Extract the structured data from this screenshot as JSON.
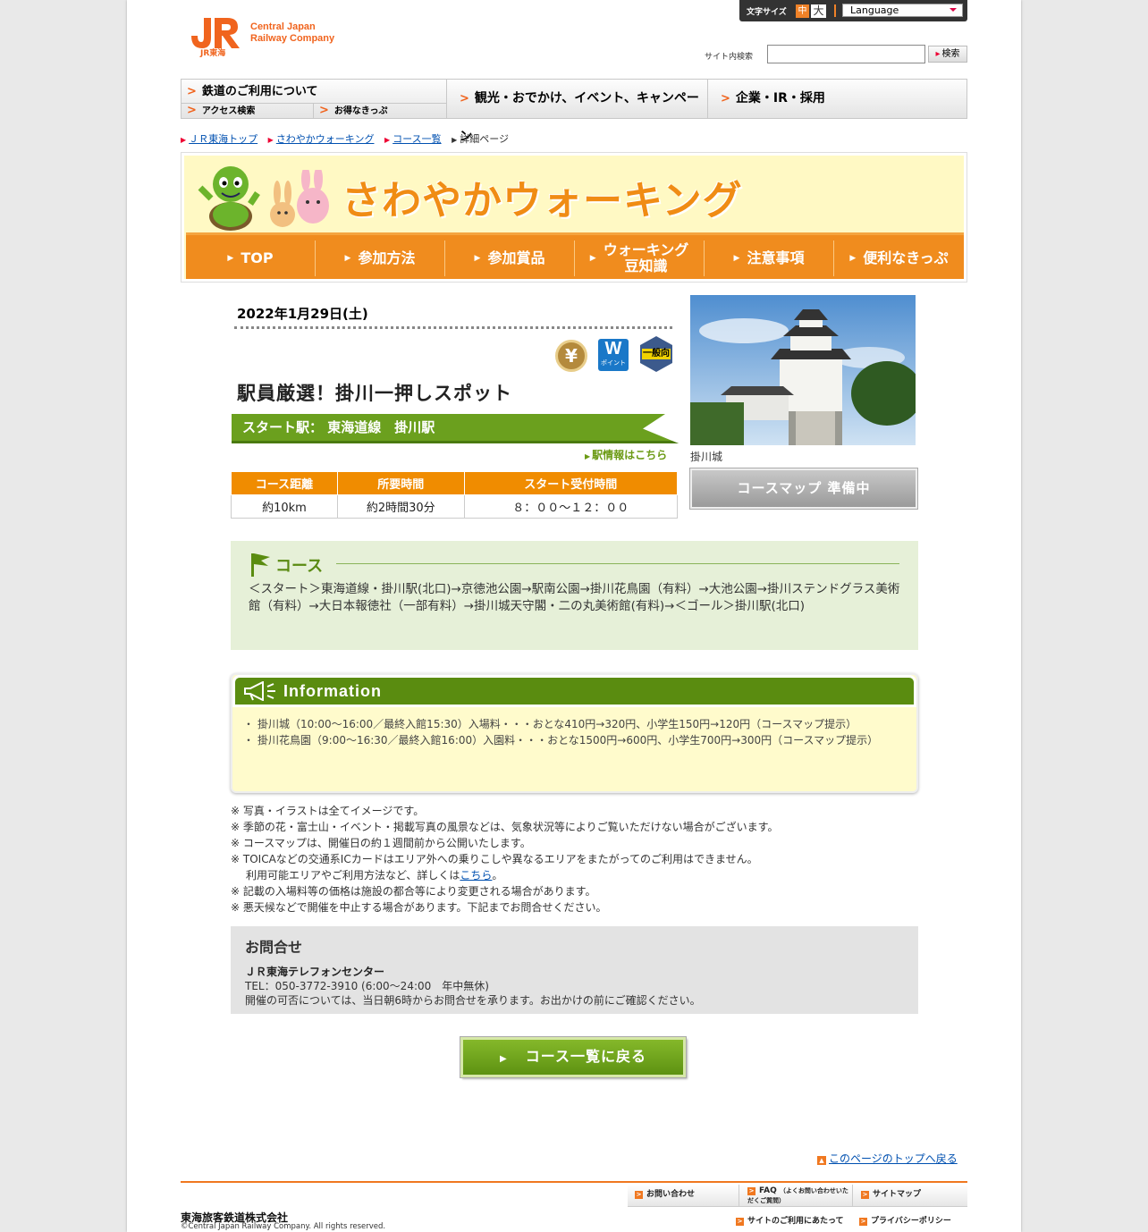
{
  "header": {
    "logo_sub": "JR東海",
    "logo_en_line1": "Central Japan",
    "logo_en_line2": "Railway Company",
    "font_size_label": "文字サイズ",
    "font_size_mid": "中",
    "font_size_large": "大",
    "language_label": "Language",
    "search_label": "サイト内検索",
    "search_value": "",
    "search_button": "検索"
  },
  "global_nav": {
    "rail": "鉄道のご利用について",
    "access": "アクセス検索",
    "tickets": "お得なきっぷ",
    "tourism": "観光・おでかけ、イベント、キャンペーン",
    "corporate": "企業・IR・採用"
  },
  "breadcrumb": [
    "ＪＲ東海トップ",
    "さわやかウォーキング",
    "コース一覧",
    "詳細ページ"
  ],
  "hero": {
    "title": "さわやかウォーキング",
    "nav": [
      "TOP",
      "参加方法",
      "参加賞品",
      "ウォーキング豆知識",
      "注意事項",
      "便利なきっぷ"
    ],
    "nav_line1_walking": "ウォーキング",
    "nav_line2_walking": "豆知識"
  },
  "detail": {
    "date": "2022年1月29日(土)",
    "badges": {
      "yen": "¥",
      "w": "W",
      "w_sub": "ポイント",
      "general": "一般向"
    },
    "title": "駅員厳選！掛川一押しスポット",
    "start_label": "スタート駅：",
    "start_station": "東海道線　掛川駅",
    "station_link": "駅情報はこちら",
    "table_headers": [
      "コース距離",
      "所要時間",
      "スタート受付時間"
    ],
    "table_values": [
      "約10km",
      "約2時間30分",
      "８：００～１２：００"
    ],
    "photo_caption": "掛川城",
    "map_button": "コースマップ 準備中"
  },
  "course": {
    "heading": "コース",
    "route": "＜スタート＞東海道線・掛川駅(北口)→京徳池公園→駅南公園→掛川花鳥園（有料）→大池公園→掛川ステンドグラス美術館（有料）→大日本報徳社（一部有料）→掛川城天守閣・二の丸美術館(有料)→＜ゴール＞掛川駅(北口)"
  },
  "information": {
    "heading": "Information",
    "items": [
      "掛川城（10:00～16:00／最終入館15:30）入場料・・・おとな410円→320円、小学生150円→120円（コースマップ提示）",
      "掛川花鳥園（9:00～16:30／最終入館16:00）入園料・・・おとな1500円→600円、小学生700円→300円（コースマップ提示）"
    ]
  },
  "notes": {
    "n1": "写真・イラストは全てイメージです。",
    "n2": "季節の花・富士山・イベント・掲載写真の風景などは、気象状況等によりご覧いただけない場合がございます。",
    "n3": "コースマップは、開催日の約１週間前から公開いたします。",
    "n4a": "TOICAなどの交通系ICカードはエリア外への乗りこしや異なるエリアをまたがってのご利用はできません。",
    "n4b_pre": "利用可能エリアやご利用方法など、詳しくは",
    "n4b_link": "こちら",
    "n4b_post": "。",
    "n5": "記載の入場料等の価格は施設の都合等により変更される場合があります。",
    "n6": "悪天候などで開催を中止する場合があります。下記までお問合せください。"
  },
  "contact": {
    "heading": "お問合せ",
    "org": "ＪＲ東海テレフォンセンター",
    "tel": "TEL：050-3772-3910 (6:00～24:00　年中無休)",
    "note": "開催の可否については、当日朝6時からお問合せを承ります。お出かけの前にご確認ください。"
  },
  "back_button": "コース一覧に戻る",
  "page_top": "このページのトップへ戻る",
  "footer": {
    "contact": "お問い合わせ",
    "faq": "FAQ",
    "faq_sub": "（よくお問い合わせいただくご質問）",
    "sitemap": "サイトマップ",
    "terms": "サイトのご利用にあたって",
    "privacy": "プライバシーポリシー",
    "company": "東海旅客鉄道株式会社",
    "copyright": "©Central Japan Railway Company. All rights reserved."
  },
  "colors": {
    "jr_orange": "#f0641e",
    "walking_orange": "#f08c1e",
    "green": "#5a8c10"
  }
}
